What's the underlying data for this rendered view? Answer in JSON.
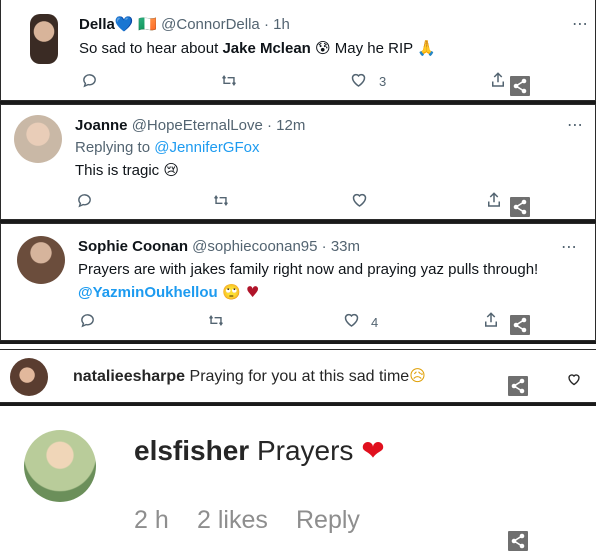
{
  "tweets": [
    {
      "name": "Della",
      "name_emoji": "💙 🇮🇪",
      "handle": "@ConnorDella",
      "time": "· 1h",
      "text_before": "So sad to hear about ",
      "text_bold": "Jake Mclean",
      "text_after": " 😰 May he RIP 🙏",
      "likes": "3"
    },
    {
      "name": "Joanne",
      "handle": "@HopeEternalLove",
      "time": "· 12m",
      "replying_prefix": "Replying to ",
      "replying_to": "@JenniferGFox",
      "text": "This is tragic 😢"
    },
    {
      "name": "Sophie Coonan",
      "handle": "@sophiecoonan95",
      "time": "· 33m",
      "text_line1": "Prayers are with jakes family right now and praying yaz pulls through!",
      "mention": "@YazminOukhellou",
      "text_after_mention": " 🙄 ♥",
      "likes": "4"
    }
  ],
  "instagram_comments": [
    {
      "username": "natalieesharpe",
      "text": "Praying for you at this sad time",
      "emoji": "😥"
    },
    {
      "username": "elsfisher",
      "text": "Prayers",
      "emoji": "❤",
      "time": "2 h",
      "likes": "2 likes",
      "reply": "Reply"
    }
  ],
  "icons": {
    "more": "⋯",
    "reply": "reply-bubble-icon",
    "retweet": "retweet-icon",
    "like": "heart-icon",
    "share": "share-icon",
    "overlay_share": "share-nodes-icon"
  },
  "colors": {
    "link": "#1d9bf0",
    "muted": "#536471",
    "heart_red": "#ed4956"
  }
}
